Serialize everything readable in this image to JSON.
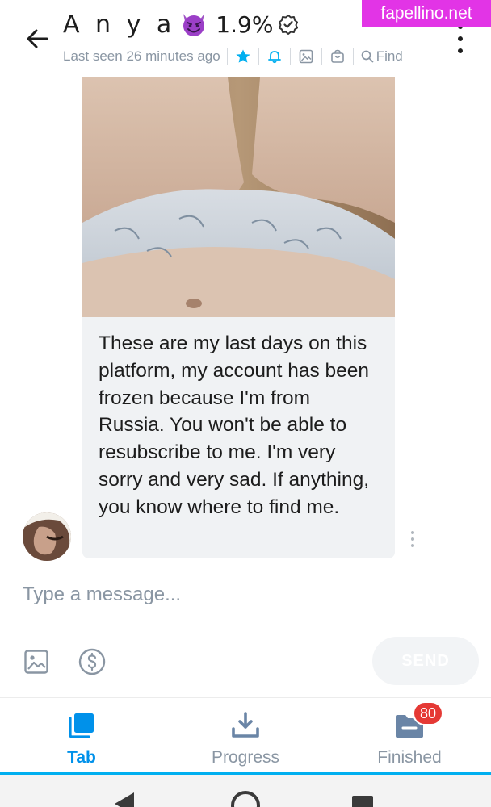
{
  "watermark": "fapellino.net",
  "header": {
    "name": "A n y a",
    "percent": "1.9%",
    "last_seen": "Last seen 26 minutes ago",
    "find_label": "Find"
  },
  "chat": {
    "message": "These are my last days on this platform, my account has been frozen because I'm from Russia. You won't be able to resubscribe to me. I'm very sorry and very sad. If anything, you know where to find me."
  },
  "composer": {
    "placeholder": "Type a message...",
    "send_label": "SEND"
  },
  "tabs": [
    {
      "label": "Tab",
      "active": true,
      "icon": "collections-icon"
    },
    {
      "label": "Progress",
      "active": false,
      "icon": "download-icon"
    },
    {
      "label": "Finished",
      "active": false,
      "icon": "folder-icon",
      "badge": "80"
    }
  ],
  "colors": {
    "accent": "#00aff0",
    "tab_active": "#0091ea",
    "muted": "#8a96a3",
    "badge": "#e53935",
    "watermark": "#e234e6"
  }
}
